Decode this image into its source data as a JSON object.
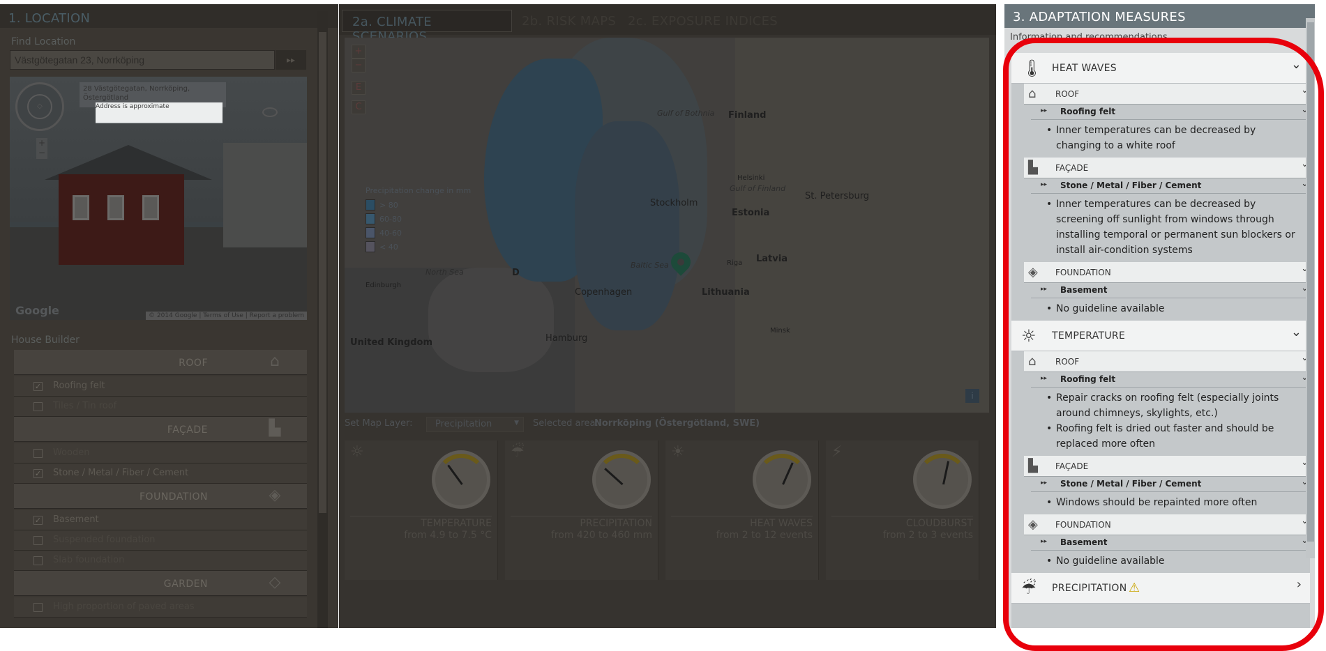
{
  "left": {
    "title": "1. LOCATION",
    "find_label": "Find Location",
    "find_value": "Västgötegatan 23, Norrköping",
    "find_go": "▸▸",
    "streetview": {
      "address": "28 Västgötegatan, Norrköping, Östergötland",
      "address_note": "Address is approximate",
      "google": "Google",
      "terms": "© 2014 Google  |  Terms of Use  |  Report a problem"
    },
    "house_builder_label": "House Builder",
    "groups": [
      {
        "title": "ROOF",
        "icon": "roof-icon",
        "items": [
          {
            "label": "Roofing felt",
            "checked": true
          },
          {
            "label": "Tiles / Tin roof",
            "checked": false
          }
        ]
      },
      {
        "title": "FAÇADE",
        "icon": "facade-icon",
        "items": [
          {
            "label": "Wooden",
            "checked": false
          },
          {
            "label": "Stone / Metal / Fiber / Cement",
            "checked": true
          }
        ]
      },
      {
        "title": "FOUNDATION",
        "icon": "foundation-icon",
        "items": [
          {
            "label": "Basement",
            "checked": true
          },
          {
            "label": "Suspended foundation",
            "checked": false
          },
          {
            "label": "Slab foundation",
            "checked": false
          }
        ]
      },
      {
        "title": "GARDEN",
        "icon": "garden-icon",
        "items": [
          {
            "label": "High proportion of paved areas",
            "checked": false
          }
        ]
      }
    ]
  },
  "middle": {
    "tabs": [
      "2a. CLIMATE SCENARIOS",
      "2b. RISK MAPS",
      "2c. EXPOSURE INDICES"
    ],
    "legend": {
      "title": "Precipitation change in mm",
      "items": [
        {
          "label": "> 80",
          "color": "#2b4d63"
        },
        {
          "label": "60-80",
          "color": "#37586e"
        },
        {
          "label": "40-60",
          "color": "#4a5569"
        },
        {
          "label": "< 40",
          "color": "#55535e"
        }
      ]
    },
    "map_labels": {
      "finland": "Finland",
      "gulf_bothnia": "Gulf of Bothnia",
      "helsinki": "Helsinki",
      "gulf_finland": "Gulf of Finland",
      "stpetersburg": "St. Petersburg",
      "stockholm": "Stockholm",
      "estonia": "Estonia",
      "latvia": "Latvia",
      "riga": "Riga",
      "baltic": "Baltic Sea",
      "north_sea": "North Sea",
      "edinburgh": "Edinburgh",
      "copenhagen": "Copenhagen",
      "lithuania": "Lithuania",
      "minsk": "Minsk",
      "hamburg": "Hamburg",
      "uk": "United Kingdom",
      "d": "D"
    },
    "layer_label": "Set Map Layer:",
    "layer_value": "Precipitation",
    "selected_label": "Selected area:",
    "selected_value": "Norrköping (Östergötland, SWE)",
    "gauges": [
      {
        "name": "TEMPERATURE",
        "range": "from 4.9 to 7.5 °C",
        "icon": "sun-icon",
        "level": 0.35
      },
      {
        "name": "PRECIPITATION",
        "range": "from 420 to 460 mm",
        "icon": "rain-icon",
        "level": 0.3
      },
      {
        "name": "HEAT WAVES",
        "range": "from 2 to 12 events",
        "icon": "heat-icon",
        "level": 0.6
      },
      {
        "name": "CLOUDBURST",
        "range": "from 2 to 3 events",
        "icon": "cloudburst-icon",
        "level": 0.55
      }
    ]
  },
  "right": {
    "title": "3. ADAPTATION MEASURES",
    "info": "Information and recommendations",
    "sections": [
      {
        "title": "HEAT WAVES",
        "icon": "thermometer-icon",
        "subs": [
          {
            "title": "ROOF",
            "icon": "roof-icon",
            "material": "Roofing felt",
            "bullets": [
              "Inner temperatures can be decreased by changing to a white roof"
            ]
          },
          {
            "title": "FAÇADE",
            "icon": "facade-icon",
            "material": "Stone / Metal / Fiber / Cement",
            "bullets": [
              "Inner temperatures can be decreased by screening off sunlight from windows through installing temporal or permanent sun blockers or install air-condition systems"
            ]
          },
          {
            "title": "FOUNDATION",
            "icon": "foundation-icon",
            "material": "Basement",
            "bullets": [
              "No guideline available"
            ]
          }
        ]
      },
      {
        "title": "TEMPERATURE",
        "icon": "sun-icon",
        "subs": [
          {
            "title": "ROOF",
            "icon": "roof-icon",
            "material": "Roofing felt",
            "bullets": [
              "Repair cracks on roofing felt (especially joints around chimneys, skylights, etc.)",
              "Roofing felt is dried out faster and should be replaced more often"
            ]
          },
          {
            "title": "FAÇADE",
            "icon": "facade-icon",
            "material": "Stone / Metal / Fiber / Cement",
            "bullets": [
              "Windows should be repainted more often"
            ]
          },
          {
            "title": "FOUNDATION",
            "icon": "foundation-icon",
            "material": "Basement",
            "bullets": [
              "No guideline available"
            ]
          }
        ]
      },
      {
        "title": "PRECIPITATION",
        "icon": "rain-icon",
        "warning": "⚠",
        "subs": []
      }
    ]
  }
}
